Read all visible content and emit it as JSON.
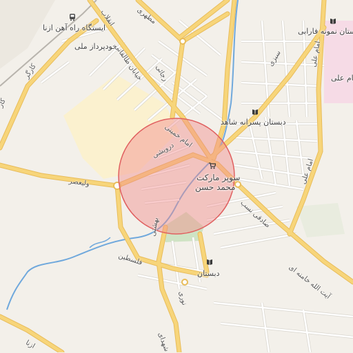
{
  "map": {
    "colors": {
      "background": "#f3f0ea",
      "major_road": "#f7d57a",
      "major_road_casing": "#e8bc5a",
      "minor_road": "#ffffff",
      "minor_road_casing": "#d9d6cf",
      "river": "#6fa8dc",
      "park": "#cfe3c4",
      "zone_yellow": "#fbf1cf",
      "zone_pink": "#f6dbe6",
      "highlight_fill": "#f28b8b",
      "highlight_stroke": "#e06060"
    },
    "labels": {
      "station": "ایستگاه راه آهن ازنا",
      "khodro": "خودپرداز ملی",
      "school_farabi": "دبستان نمونه فارابی",
      "imam_ali_place": "امام علی",
      "school_shahed": "دبستان پسرانه شاهد",
      "supermarket_line1": "سوپر مارکت",
      "supermarket_line2": "محمد حسن",
      "school_bottom": "دبستان"
    },
    "roads": {
      "karegar": "کارگر",
      "karegar2": "کار",
      "valiasr": "ولیعصر",
      "enghelab": "انقلاب",
      "motahari": "مطهری",
      "khiaban_taleghani": "خیابان طالقانی",
      "rajaei": "رجائی",
      "imam_khomeini": "امام خمینی",
      "dorvishi": "درویشی",
      "sabri": "سبزی",
      "imam_ali": "امام علی",
      "imam_ali2": "امام علی",
      "sadeghi_nasab": "صادقی نسب",
      "ayatollah": "آیت الله خامنه ای",
      "felestin": "فلسطین",
      "beheshti": "بهشتی",
      "shohada": "شهدای",
      "azna": "ازنا",
      "noori": "نوری"
    },
    "icons": {
      "station": "train-icon",
      "school": "school-icon",
      "shop": "shop-icon"
    }
  }
}
